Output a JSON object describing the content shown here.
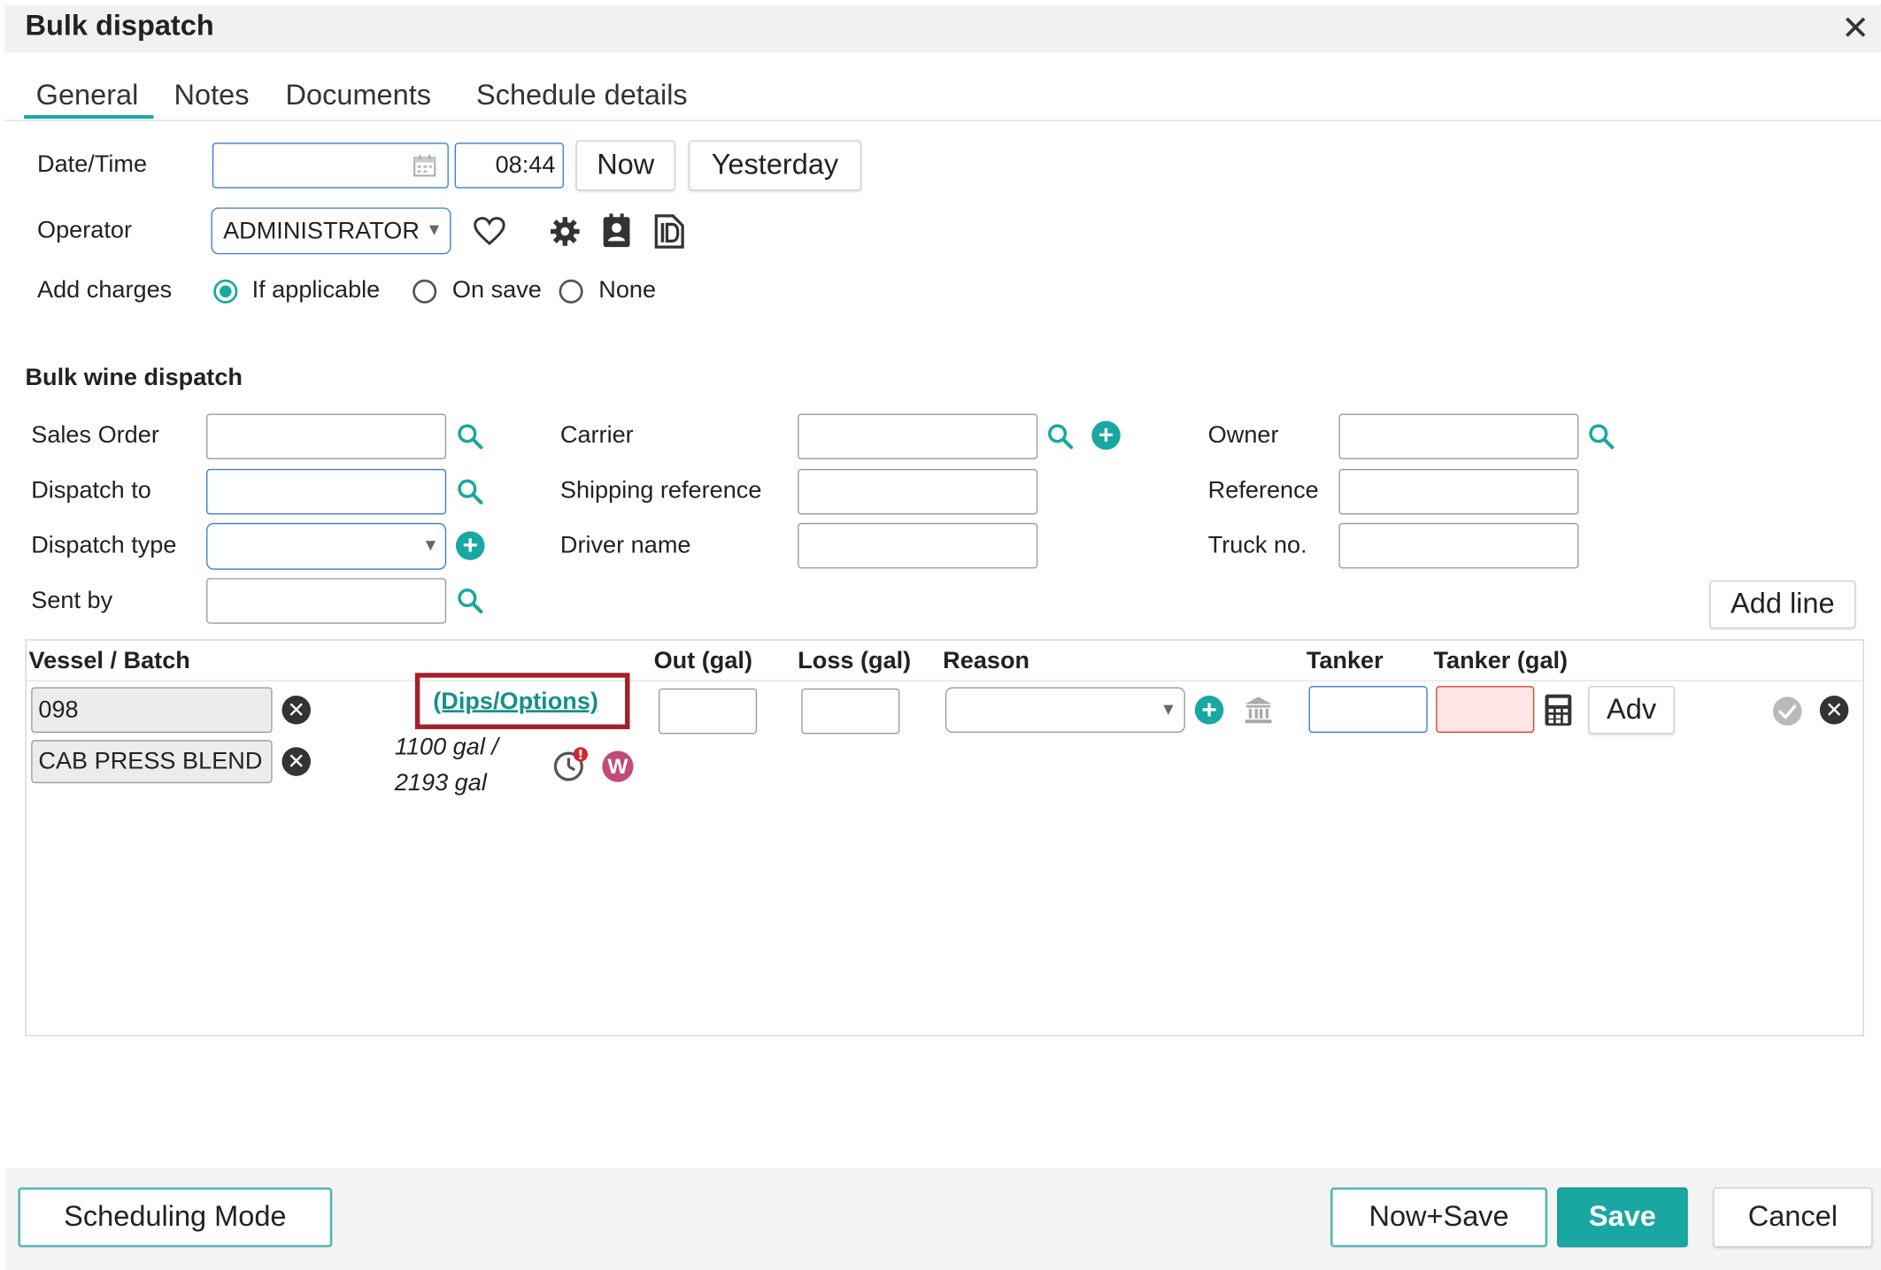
{
  "window": {
    "title": "Bulk dispatch",
    "close_icon": "close-icon"
  },
  "tabs": [
    {
      "label": "General",
      "active": true
    },
    {
      "label": "Notes",
      "active": false
    },
    {
      "label": "Documents",
      "active": false
    },
    {
      "label": "Schedule details",
      "active": false
    }
  ],
  "general": {
    "date_time_label": "Date/Time",
    "date_value": "",
    "time_value": "08:44",
    "now_label": "Now",
    "yesterday_label": "Yesterday",
    "operator_label": "Operator",
    "operator_value": "ADMINISTRATOR",
    "add_charges_label": "Add charges",
    "add_charges_options": [
      "If applicable",
      "On save",
      "None"
    ],
    "add_charges_selected": "If applicable"
  },
  "bulk": {
    "section_title": "Bulk wine dispatch",
    "sales_order_label": "Sales Order",
    "dispatch_to_label": "Dispatch to",
    "dispatch_type_label": "Dispatch type",
    "sent_by_label": "Sent by",
    "carrier_label": "Carrier",
    "shipping_reference_label": "Shipping reference",
    "driver_name_label": "Driver name",
    "owner_label": "Owner",
    "reference_label": "Reference",
    "truck_no_label": "Truck no.",
    "add_line_label": "Add line"
  },
  "grid": {
    "headers": {
      "vessel_batch": "Vessel / Batch",
      "out": "Out (gal)",
      "loss": "Loss (gal)",
      "reason": "Reason",
      "tanker": "Tanker",
      "tanker_gal": "Tanker (gal)"
    },
    "row": {
      "vessel": "098",
      "batch": "CAB PRESS BLEND",
      "dips_link": "(Dips/Options)",
      "volume_line1": "1100 gal /",
      "volume_line2": "2193 gal",
      "badge_letter": "W",
      "adv_label": "Adv"
    }
  },
  "footer": {
    "scheduling_mode_label": "Scheduling Mode",
    "now_save_label": "Now+Save",
    "save_label": "Save",
    "cancel_label": "Cancel"
  },
  "colors": {
    "accent": "#19a7a2",
    "highlight_box": "#a3202a",
    "error_fill": "#fde6e4",
    "badge_w": "#c24a7a"
  }
}
